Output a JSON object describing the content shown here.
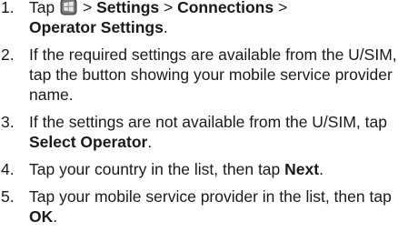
{
  "steps": [
    {
      "number": "1.",
      "tap": "Tap",
      "sep": ">",
      "settings": "Settings",
      "connections": "Connections",
      "operator_settings": "Operator Settings",
      "end": "."
    },
    {
      "number": "2.",
      "text": "If the required settings are available from the U/SIM, tap the button showing your mobile service provider name."
    },
    {
      "number": "3.",
      "pre": "If the settings are not available from the U/SIM, tap",
      "bold": "Select Operator",
      "end": "."
    },
    {
      "number": "4.",
      "pre": "Tap your country in the list, then tap",
      "bold": "Next",
      "end": "."
    },
    {
      "number": "5.",
      "pre": "Tap your mobile service provider in the list, then tap",
      "bold": "OK",
      "end": "."
    }
  ],
  "icons": {
    "start": "windows-start-icon"
  },
  "colors": {
    "text": "#1a1a1a"
  }
}
